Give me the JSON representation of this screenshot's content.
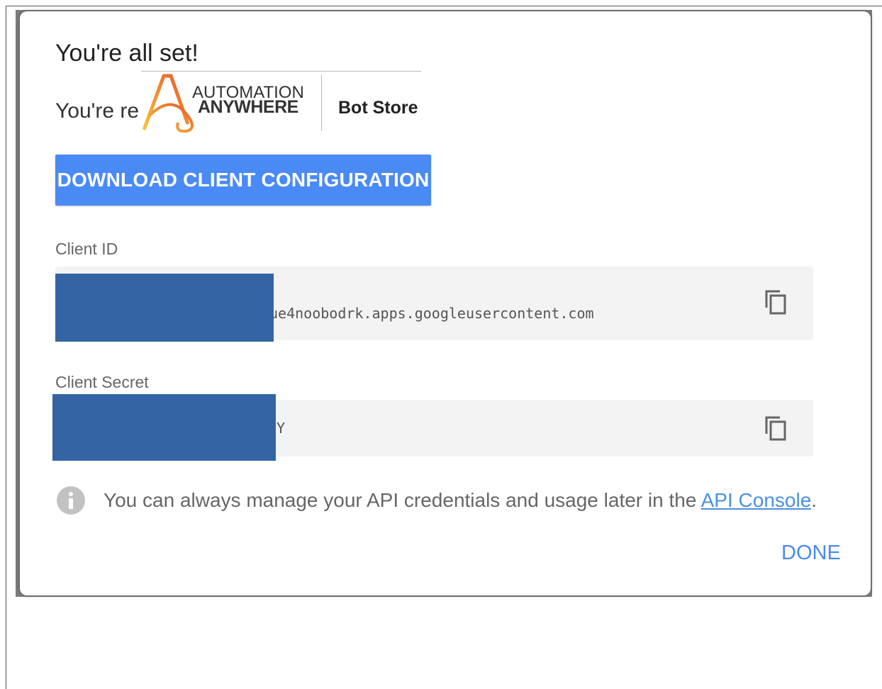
{
  "dialog": {
    "title": "You're all set!",
    "subtitle_visible": "You're re",
    "download_button": "DOWNLOAD CLIENT CONFIGURATION",
    "client_id": {
      "label": "Client ID",
      "value_visible": "ue4noobodrk.apps.googleusercontent.com"
    },
    "client_secret": {
      "label": "Client Secret",
      "value_visible": "tY"
    },
    "info": {
      "text": "You can always manage your API credentials and usage later in the ",
      "link": "API Console",
      "suffix": "."
    },
    "done_button": "DONE"
  },
  "overlay_logo": {
    "brand_line1": "AUTOMATION",
    "brand_line2": "ANYWHERE",
    "store": "Bot Store"
  },
  "colors": {
    "primary_button": "#4a8af4",
    "link": "#4a90e2",
    "redaction": "#3464a4",
    "field_background": "#f3f3f3",
    "backdrop": "#7d7d7d"
  },
  "icons": [
    "copy-icon",
    "info-icon",
    "automation-anywhere-logo"
  ]
}
